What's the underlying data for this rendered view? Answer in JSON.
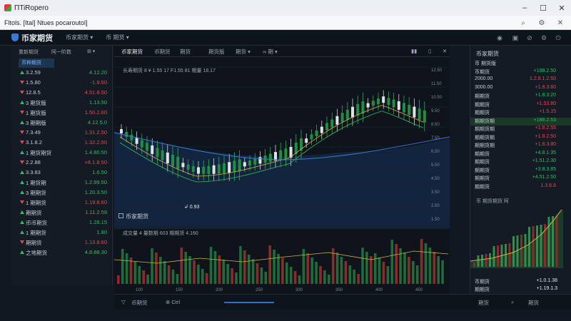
{
  "window": {
    "title": "ΠTiRopero",
    "controls": [
      "–",
      "☐",
      "✕"
    ]
  },
  "address": {
    "url": "Fltols. [Ital] Ntues pocaroutol]"
  },
  "app": {
    "brand": "币家期货",
    "header_buttons": [
      "币家期货 ▾",
      "币 期货 ▾"
    ]
  },
  "left_panel": {
    "tabs": [
      "重新期货",
      "阿一阶数",
      "⊞ ▾"
    ],
    "selected_tab": "币种期货",
    "rows": [
      {
        "name": "3.2.59",
        "value": "4.12.20",
        "up": true
      },
      {
        "name": "1.5.80",
        "value": "-1.9.50",
        "up": false
      },
      {
        "name": "12.8.5",
        "value": "4.51.8.50",
        "up": false
      },
      {
        "name": "3 期货版",
        "value": "1.13.50",
        "up": true
      },
      {
        "name": "1 期货版",
        "value": "1.50.2.60",
        "up": false
      },
      {
        "name": "3 期期版",
        "value": "4.12.5.0",
        "up": true
      },
      {
        "name": "7.3.49",
        "value": "1.31.2.50",
        "up": false
      },
      {
        "name": "3.1.8.2",
        "value": "1.32.2.50",
        "up": false
      },
      {
        "name": "1 期货期货",
        "value": "1.4.80.50",
        "up": true
      },
      {
        "name": "2.2.88",
        "value": "+8.1.8.50",
        "up": false
      },
      {
        "name": "3.3.83",
        "value": "1.6.50",
        "up": true
      },
      {
        "name": "1 期货期",
        "value": "1.2.99.50",
        "up": true
      },
      {
        "name": "3 期期货",
        "value": "1.20.3.50",
        "up": true
      },
      {
        "name": "1 期期货",
        "value": "1.19.8.60",
        "up": false
      },
      {
        "name": "期期货",
        "value": "1.11.2.59",
        "up": true
      },
      {
        "name": "币币期货",
        "value": "1.28.15",
        "up": true
      },
      {
        "name": "1 期期货",
        "value": "1.80",
        "up": true
      },
      {
        "name": "期期货",
        "value": "1.13.8.60",
        "up": false
      },
      {
        "name": "之地期货",
        "value": "4.8.88.30",
        "up": true
      }
    ]
  },
  "center": {
    "tabs": [
      "币家期货",
      "币期货",
      "期货",
      "期货版",
      "期货 ▾",
      "∞ 期 ▾"
    ],
    "chart_info": "长寿期货 8 ¥ 1.55 17 F1.55 81 期量  18.17",
    "chart_title": "币家期货",
    "volume_info": "成交量 4  量数期  603  期期货  4.160",
    "price_axis": [
      "12.50",
      "11.50",
      "10.50",
      "9.50",
      "8.50",
      "7.50",
      "6.50",
      "5.50",
      "4.50",
      "3.50",
      "2.50",
      "1.50"
    ],
    "low_label": "0.93",
    "x_axis": [
      "100",
      "150",
      "200",
      "250",
      "300",
      "350",
      "400",
      "450",
      "500"
    ]
  },
  "right_panel": {
    "title": "币家期货",
    "rows": [
      {
        "name": "币 期货版",
        "value": "",
        "up": true
      },
      {
        "name": "币期货",
        "value": "+198.2.50",
        "up": true
      },
      {
        "name": "2000.00",
        "value": "1.2.8.1.2.50",
        "up": false
      },
      {
        "name": "3000.00",
        "value": "+1.8.3.60",
        "up": false
      },
      {
        "name": "期期货",
        "value": "+1.8.3.20",
        "up": true
      },
      {
        "name": "期期货",
        "value": "+1.53.80",
        "up": false
      },
      {
        "name": "期期货",
        "value": "+1.5.15",
        "up": false
      },
      {
        "name": "期期货期",
        "value": "+188.2.53",
        "up": true
      },
      {
        "name": "期期货期",
        "value": "+1.8.2.55",
        "up": false
      },
      {
        "name": "期期货期",
        "value": "+1.8.2.50",
        "up": false
      },
      {
        "name": "期期货期",
        "value": "+1.8.3.80",
        "up": false
      },
      {
        "name": "期期货",
        "value": "+4.8.1.35",
        "up": true
      },
      {
        "name": "期期货",
        "value": "+1.51.2.30",
        "up": true
      },
      {
        "name": "期期货",
        "value": "+3.8.3.85",
        "up": true
      },
      {
        "name": "期期货",
        "value": "+4.51.2.50",
        "up": true
      },
      {
        "name": "期期货",
        "value": "1.3.6.8",
        "up": false
      }
    ],
    "sub_title": "币 期货期货 阿",
    "bottom_rows": [
      {
        "name": "币期货",
        "value": "+1.0.1.38",
        "up": false
      },
      {
        "name": "期期货",
        "value": "+1.19.1.3",
        "up": false
      }
    ]
  },
  "bottom_bar": {
    "items": [
      "币期货",
      "⊕ Ctrl",
      "期货",
      "期货"
    ]
  }
}
